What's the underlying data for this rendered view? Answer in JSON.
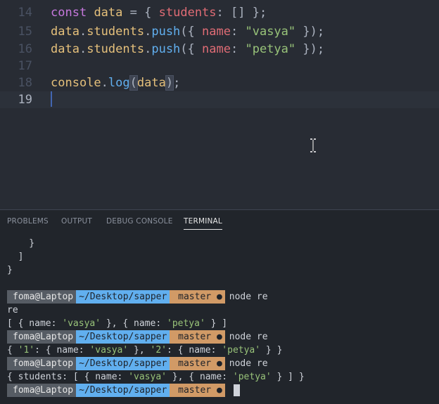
{
  "editor": {
    "lines": [
      {
        "number": "14"
      },
      {
        "number": "15"
      },
      {
        "number": "16"
      },
      {
        "number": "17"
      },
      {
        "number": "18"
      },
      {
        "number": "19"
      }
    ],
    "code": {
      "l14": {
        "kw": "const",
        "var": "data",
        "eq": "=",
        "open": "{",
        "prop": "students",
        "colon": ":",
        "arr": "[]",
        "close": "};"
      },
      "l15": {
        "obj": "data",
        "dot1": ".",
        "prop": "students",
        "dot2": ".",
        "fn": "push",
        "open": "({",
        "key": "name",
        "colon": ":",
        "val": "\"vasya\"",
        "close": "});"
      },
      "l16": {
        "obj": "data",
        "dot1": ".",
        "prop": "students",
        "dot2": ".",
        "fn": "push",
        "open": "({",
        "key": "name",
        "colon": ":",
        "val": "\"petya\"",
        "close": "});"
      },
      "l18": {
        "obj": "console",
        "dot": ".",
        "fn": "log",
        "lp": "(",
        "arg": "data",
        "rp": ")",
        "semi": ";"
      }
    }
  },
  "panel": {
    "tabs": [
      "PROBLEMS",
      "OUTPUT",
      "DEBUG CONSOLE",
      "TERMINAL"
    ],
    "active_tab": "TERMINAL",
    "terminal": {
      "trail": [
        "    }",
        "  ]",
        "}"
      ],
      "prompt": {
        "user": "foma@Laptop",
        "path": "~/Desktop/sapper",
        "branch": "master",
        "dirty": "●",
        "sep": ""
      },
      "commands": [
        "node re",
        "node re",
        "node re"
      ],
      "outputs": {
        "o1a": "re",
        "o1b": "[ { name: 'vasya' }, { name: 'petya' } ]",
        "o2": "{ '1': { name: 'vasya' }, '2': { name: 'petya' } }",
        "o3": "{ students: [ { name: 'vasya' }, { name: 'petya' } ] }"
      }
    }
  },
  "colors": {
    "background": "#282c34",
    "panel_bg": "#21252b",
    "keyword": "#c678dd",
    "variable": "#e5c07b",
    "property": "#e06c75",
    "string": "#98c379",
    "function": "#61afef",
    "prompt_path": "#61afef",
    "prompt_git": "#d19a66"
  }
}
